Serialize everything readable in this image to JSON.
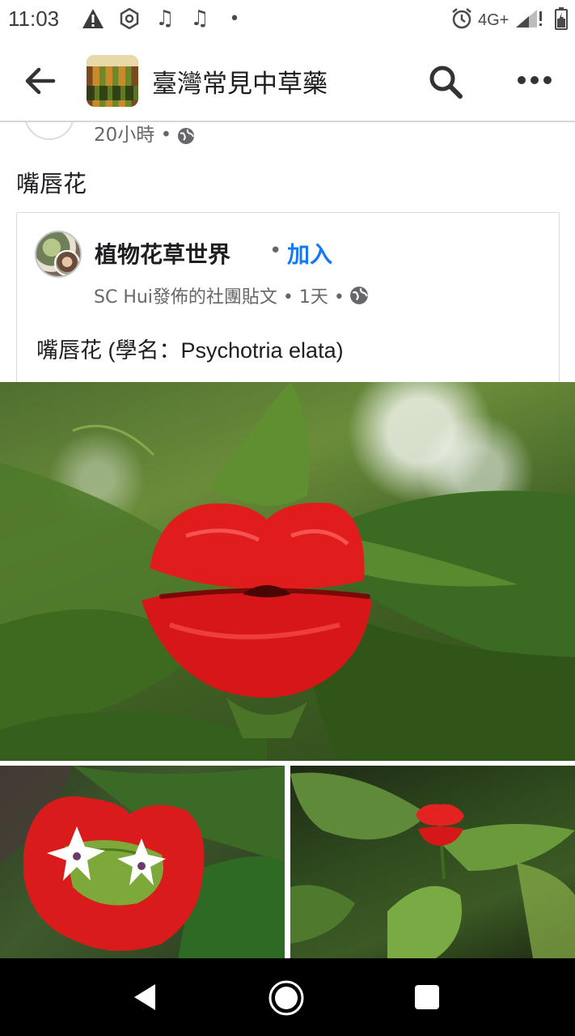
{
  "status_bar": {
    "time": "11:03",
    "network": "4G+",
    "icons": [
      "warning-icon",
      "gear-icon",
      "music-note-icon",
      "music-note-icon",
      "dot-icon",
      "alarm-icon",
      "signal-icon",
      "battery-icon"
    ]
  },
  "header": {
    "title": "臺灣常見中草藥",
    "icons": [
      "back-arrow-icon",
      "search-icon",
      "more-icon"
    ]
  },
  "previous_post": {
    "meta": "20小時 •"
  },
  "post": {
    "text": "嘴唇花"
  },
  "shared_post": {
    "group_name": "植物花草世界",
    "separator": "•",
    "join_label": "加入",
    "subtitle": "SC Hui發佈的社團貼文 • 1天 •",
    "body": "嘴唇花 (學名：Psychotria elata)"
  },
  "colors": {
    "accent": "#1877f2",
    "text_primary": "#1c1e21",
    "text_secondary": "#65676b",
    "nav_bar": "#000000",
    "flower_red": "#e01c1c"
  }
}
